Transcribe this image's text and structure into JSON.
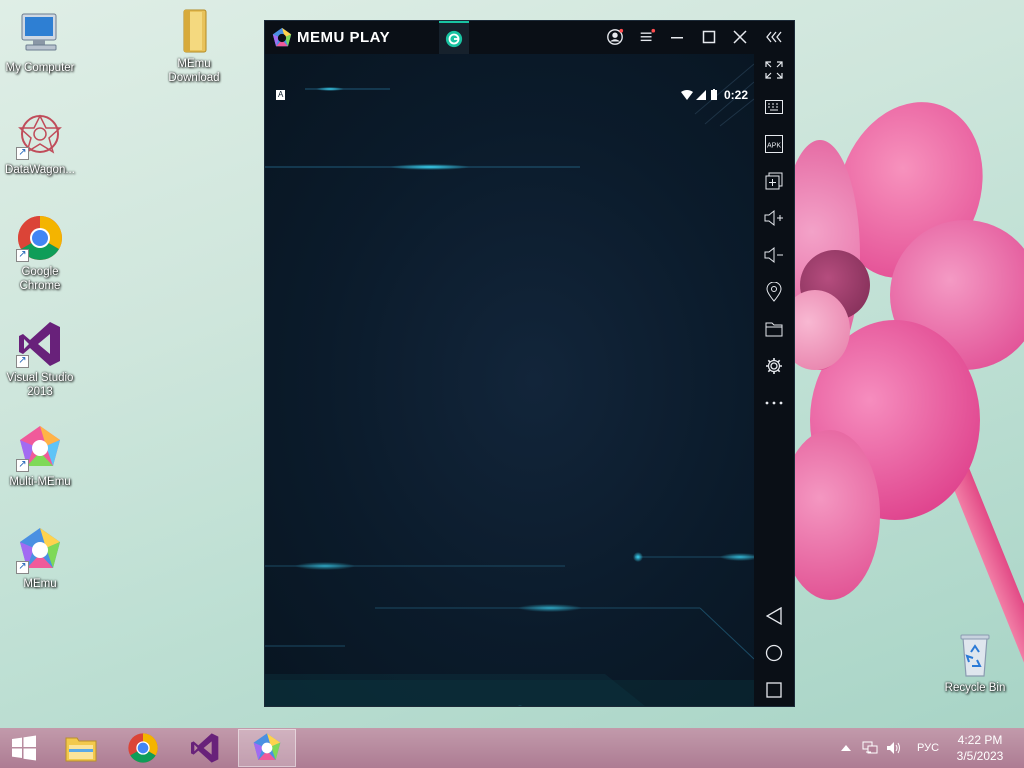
{
  "desktop": {
    "icons": [
      {
        "label": "My Computer",
        "icon": "computer-icon"
      },
      {
        "label": "MEmu Download",
        "icon": "folder-icon"
      },
      {
        "label": "DataWagon...",
        "icon": "datawagon-icon"
      },
      {
        "label": "Google Chrome",
        "icon": "chrome-icon"
      },
      {
        "label": "Visual Studio 2013",
        "icon": "visual-studio-icon"
      },
      {
        "label": "Multi-MEmu",
        "icon": "multi-memu-icon"
      },
      {
        "label": "MEmu",
        "icon": "memu-icon"
      },
      {
        "label": "Recycle Bin",
        "icon": "recycle-bin-icon"
      }
    ]
  },
  "memu": {
    "logo_text": "MEMU PLAY",
    "status": {
      "left_badge": "A",
      "time": "0:22"
    },
    "titlebar_buttons": [
      "account-icon",
      "menu-icon",
      "minimize-icon",
      "maximize-icon",
      "close-icon",
      "collapse-icon"
    ],
    "sidebar_buttons": [
      "fullscreen-icon",
      "keyboard-icon",
      "apk-icon",
      "multi-window-icon",
      "volume-up-icon",
      "volume-down-icon",
      "location-icon",
      "folder-icon",
      "settings-icon",
      "more-icon",
      "back-icon",
      "home-icon",
      "recents-icon"
    ],
    "apk_label": "APK",
    "colors": {
      "accent": "#19c3a2",
      "titlebar": "#0a0f16",
      "screen": "#0b1b2b"
    }
  },
  "taskbar": {
    "apps": [
      "windows-start-icon",
      "file-explorer-icon",
      "chrome-icon",
      "visual-studio-icon",
      "memu-icon"
    ],
    "language": "РУС",
    "time": "4:22 PM",
    "date": "3/5/2023"
  }
}
